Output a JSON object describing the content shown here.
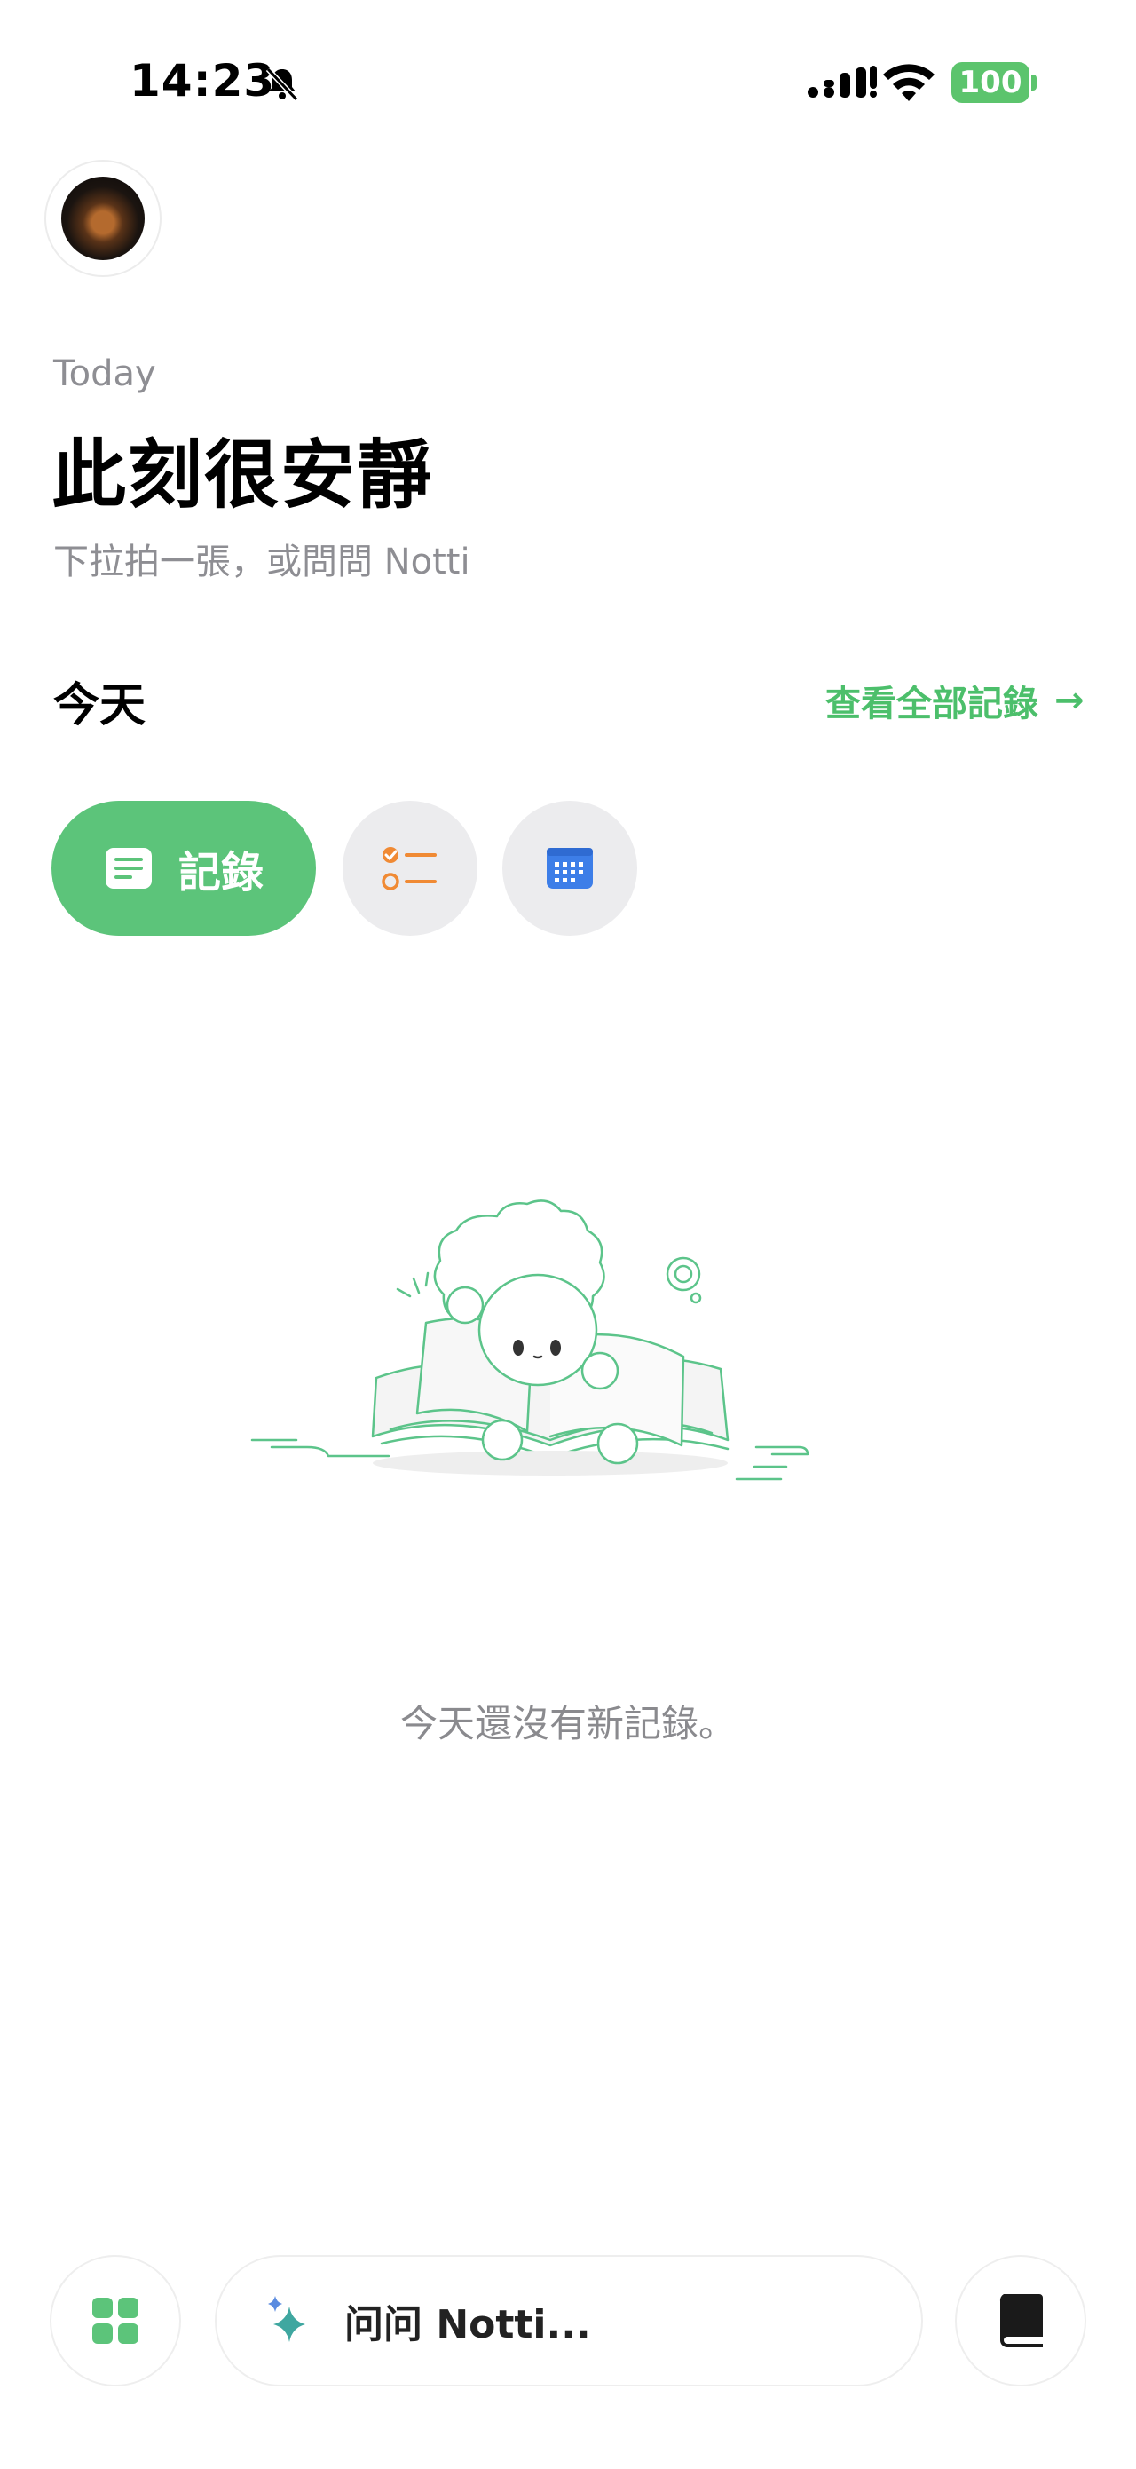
{
  "status_bar": {
    "time": "14:23",
    "battery": "100",
    "icons": [
      "bell-slash-icon",
      "signal-icon",
      "wifi-icon",
      "battery-icon"
    ]
  },
  "header": {
    "date_label": "Today",
    "headline": "此刻很安靜",
    "subtitle": "下拉拍一張，或問問 Notti"
  },
  "section": {
    "title": "今天",
    "view_all": "查看全部記錄",
    "view_all_arrow": "→"
  },
  "filters": {
    "records_label": "記錄",
    "items": [
      {
        "icon": "note-icon",
        "selected": true
      },
      {
        "icon": "checklist-icon",
        "selected": false
      },
      {
        "icon": "calendar-icon",
        "selected": false
      }
    ]
  },
  "empty_state": {
    "message": "今天還沒有新記錄。"
  },
  "bottom_bar": {
    "ask_placeholder": "问问 Notti...",
    "icons": [
      "grid-icon",
      "sparkle-icon",
      "book-icon"
    ]
  },
  "colors": {
    "accent_green": "#5cc47a",
    "link_green": "#4cbf6b",
    "battery_green": "#5cc46d",
    "task_orange": "#f08a34",
    "calendar_blue": "#3d7ee8",
    "muted_gray": "#8e8e93"
  }
}
